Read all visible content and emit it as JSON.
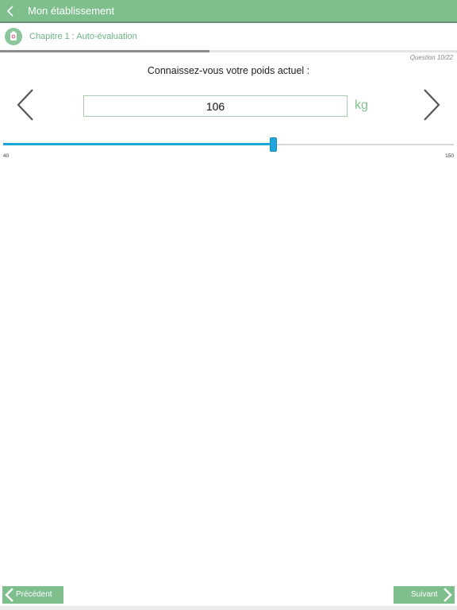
{
  "navbar": {
    "title": "Mon établissement",
    "back_icon": "chevron-left-icon"
  },
  "chapter": {
    "title": "Chapitre 1 : Auto-évaluation",
    "icon": "medical-kit-icon"
  },
  "progress": {
    "current": 10,
    "total": 22,
    "label": "Question 10/22"
  },
  "question": {
    "text": "Connaissez-vous votre poids actuel :",
    "value": "106",
    "unit": "kg",
    "prev_arrow_icon": "chevron-left-icon",
    "next_arrow_icon": "chevron-right-icon"
  },
  "slider": {
    "min": 40,
    "max": 150,
    "value": 106,
    "min_label": "40",
    "max_label": "150"
  },
  "footer": {
    "prev_label": "Précédent",
    "next_label": "Suivant"
  },
  "colors": {
    "accent_green": "#7fbf8e",
    "slider_blue": "#1ea6dc"
  }
}
